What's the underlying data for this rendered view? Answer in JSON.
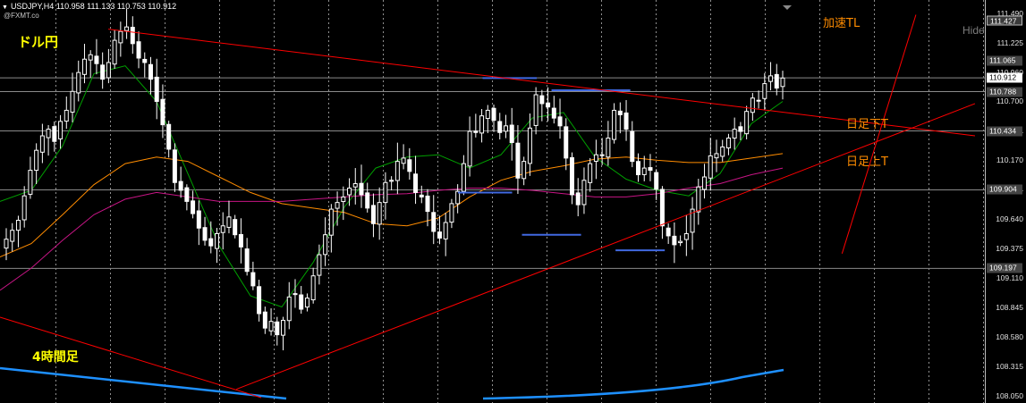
{
  "header": {
    "symbol_line": "USDJPY,H4  110.958 111.133 110.753 110.912",
    "brand": "@FXMT.co"
  },
  "labels": {
    "pair": "ドル円",
    "timeframe": "4時間足",
    "accel_tl": "加速TL",
    "daily_down_tl": "日足下T",
    "daily_up_tl": "日足上T",
    "hide_button": "Hide"
  },
  "colors": {
    "background": "#000000",
    "candle": "#ffffff",
    "grid": "#c0c0c0",
    "trendline": "#ff0000",
    "support_resistance": "#4169e1",
    "ma_short": "#00a000",
    "ma_mid": "#ff8c00",
    "ma_long": "#c71585",
    "ma_longest": "#ff0000",
    "bottom_indicator": "#1e90ff",
    "annotation": "#ff8c00",
    "title_text": "#ffff00"
  },
  "chart_data": {
    "type": "candlestick",
    "symbol": "USDJPY",
    "timeframe": "H4",
    "ohlc_current": {
      "open": 110.958,
      "high": 111.133,
      "low": 110.753,
      "close": 110.912
    },
    "ylim": [
      108.05,
      111.5
    ],
    "y_ticks": [
      111.49,
      111.225,
      110.96,
      110.7,
      110.434,
      110.17,
      109.904,
      109.64,
      109.375,
      109.11,
      108.845,
      108.58,
      108.315,
      108.05
    ],
    "price_tags": [
      {
        "value": "111.427",
        "style": "boxed"
      },
      {
        "value": "111.065",
        "style": "dark"
      },
      {
        "value": "110.912",
        "style": "current"
      },
      {
        "value": "110.788",
        "style": "dark"
      },
      {
        "value": "110.434",
        "style": "dark"
      },
      {
        "value": "109.904",
        "style": "dark"
      },
      {
        "value": "109.197",
        "style": "dark"
      }
    ],
    "grid": "dotted vertical",
    "close_series": [
      109.46,
      109.54,
      109.63,
      109.85,
      110.08,
      110.26,
      110.39,
      110.45,
      110.34,
      110.52,
      110.62,
      110.79,
      110.96,
      111.08,
      111.12,
      111.04,
      110.9,
      111.05,
      111.25,
      111.33,
      111.37,
      111.22,
      111.09,
      111.05,
      110.9,
      110.7,
      110.49,
      110.27,
      109.97,
      109.9,
      109.8,
      109.69,
      109.56,
      109.45,
      109.4,
      109.51,
      109.58,
      109.66,
      109.5,
      109.39,
      109.17,
      109.04,
      108.79,
      108.66,
      108.72,
      108.6,
      108.73,
      108.94,
      108.97,
      108.83,
      108.93,
      109.13,
      109.32,
      109.5,
      109.73,
      109.79,
      109.84,
      109.92,
      109.96,
      109.86,
      109.74,
      109.6,
      109.79,
      109.97,
      109.99,
      110.16,
      110.19,
      110.07,
      109.88,
      109.84,
      109.71,
      109.53,
      109.47,
      109.61,
      109.78,
      109.89,
      110.14,
      110.43,
      110.42,
      110.57,
      110.62,
      110.53,
      110.42,
      110.48,
      110.33,
      110.01,
      110.16,
      110.46,
      110.76,
      110.68,
      110.65,
      110.55,
      110.48,
      110.19,
      109.86,
      109.77,
      109.99,
      110.14,
      110.22,
      110.22,
      110.37,
      110.62,
      110.58,
      110.45,
      110.16,
      110.04,
      110.1,
      110.08,
      109.91,
      109.58,
      109.49,
      109.41,
      109.44,
      109.51,
      109.73,
      109.93,
      110.02,
      110.21,
      110.23,
      110.29,
      110.37,
      110.45,
      110.43,
      110.61,
      110.73,
      110.71,
      110.86,
      110.93,
      110.82,
      110.91
    ],
    "moving_averages": [
      {
        "color": "green",
        "values": [
          109.8,
          109.9,
          110.3,
          110.95,
          111.02,
          110.7,
          110.05,
          109.4,
          108.95,
          108.85,
          109.25,
          109.75,
          110.1,
          110.2,
          110.22,
          110.1,
          110.22,
          110.55,
          110.6,
          110.2,
          110.0,
          109.9,
          109.85,
          110.05,
          110.5,
          110.7
        ]
      },
      {
        "color": "orange",
        "values": [
          109.3,
          109.42,
          109.68,
          109.95,
          110.14,
          110.2,
          110.16,
          110.02,
          109.88,
          109.78,
          109.74,
          109.7,
          109.6,
          109.58,
          109.65,
          109.84,
          109.99,
          110.07,
          110.12,
          110.18,
          110.2,
          110.17,
          110.15,
          110.15,
          110.19,
          110.23
        ]
      },
      {
        "color": "magenta",
        "values": [
          109.0,
          109.2,
          109.45,
          109.68,
          109.82,
          109.88,
          109.84,
          109.8,
          109.8,
          109.8,
          109.82,
          109.84,
          109.86,
          109.87,
          109.9,
          109.92,
          109.92,
          109.9,
          109.87,
          109.84,
          109.84,
          109.87,
          109.92,
          109.96,
          110.04,
          110.1
        ]
      }
    ],
    "trendlines": [
      {
        "name": "加速TL",
        "from": [
          109.33,
          0.855
        ],
        "to": [
          111.48,
          0.93
        ]
      },
      {
        "name": "日足下T",
        "from": [
          111.35,
          0.11
        ],
        "to": [
          110.39,
          0.99
        ]
      },
      {
        "name": "日足上T",
        "from": [
          108.11,
          0.24
        ],
        "to": [
          110.68,
          0.99
        ]
      }
    ],
    "horizontal_levels": [
      110.912,
      110.788,
      110.434,
      109.904,
      109.197
    ],
    "support_resistance_segments": [
      {
        "value": 110.91,
        "from": 0.49,
        "to": 0.545
      },
      {
        "value": 110.8,
        "from": 0.56,
        "to": 0.64
      },
      {
        "value": 109.88,
        "from": 0.465,
        "to": 0.52
      },
      {
        "value": 109.5,
        "from": 0.53,
        "to": 0.59
      },
      {
        "value": 109.36,
        "from": 0.625,
        "to": 0.675
      }
    ]
  }
}
